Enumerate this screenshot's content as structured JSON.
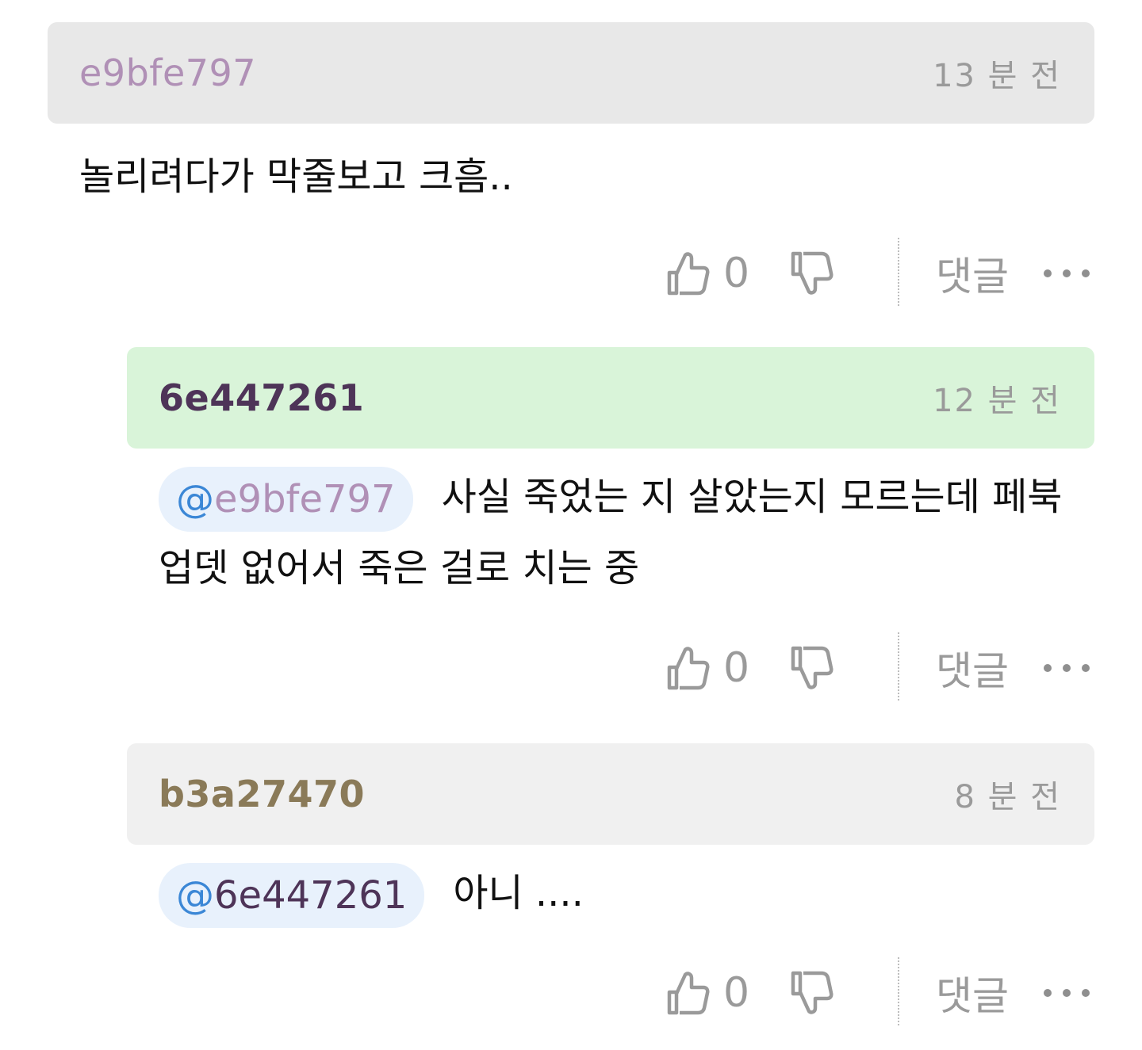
{
  "colors": {
    "header_gray": "#e8e8e8",
    "header_green": "#d9f4d9",
    "header_light_gray": "#f0f0f0",
    "mention_bg": "#e8f1fc",
    "mention_at": "#3b87d6",
    "user_e9bfe797": "#b090b6",
    "user_6e447261": "#4e3458",
    "user_b3a27470": "#8a7a58"
  },
  "comments": [
    {
      "username": "e9bfe797",
      "timestamp": "13 분 전",
      "mention": "",
      "text": "놀리려다가 막줄보고 크흠..",
      "likes": "0",
      "reply_label": "댓글"
    },
    {
      "username": "6e447261",
      "timestamp": "12 분 전",
      "mention_at": "@",
      "mention_name": "e9bfe797",
      "text": "사실 죽었는 지 살았는지 모르는데 페북 업뎃 없어서 죽은 걸로 치는 중",
      "likes": "0",
      "reply_label": "댓글"
    },
    {
      "username": "b3a27470",
      "timestamp": "8 분 전",
      "mention_at": "@",
      "mention_name": "6e447261",
      "text": "아니 ....",
      "likes": "0",
      "reply_label": "댓글"
    }
  ],
  "icons": {
    "like": "thumbs-up-icon",
    "dislike": "thumbs-down-icon",
    "more": "more-dots-icon"
  }
}
